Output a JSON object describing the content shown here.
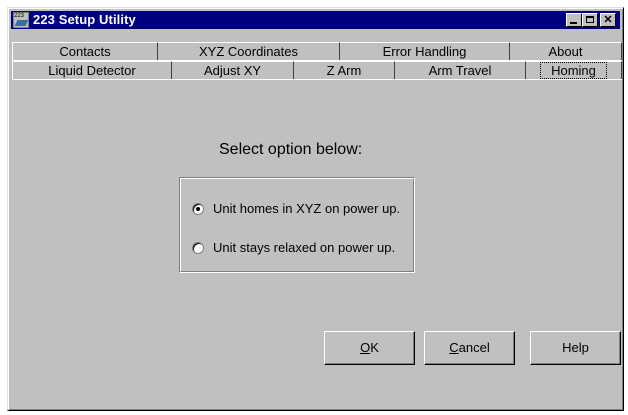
{
  "window": {
    "title": "223 Setup Utility",
    "icon_label": "223",
    "controls": [
      "minimize",
      "maximize",
      "close"
    ]
  },
  "tabs": {
    "row1": [
      "Contacts",
      "XYZ Coordinates",
      "Error Handling",
      "About"
    ],
    "row2": [
      "Liquid Detector",
      "Adjust XY",
      "Z Arm",
      "Arm Travel",
      "Homing"
    ],
    "active": "Homing"
  },
  "panel": {
    "prompt": "Select option below:",
    "options": [
      {
        "label": "Unit homes in XYZ on power up.",
        "selected": true
      },
      {
        "label": "Unit stays relaxed on power up.",
        "selected": false
      }
    ]
  },
  "buttons": {
    "ok": {
      "mnemonic": "O",
      "rest": "K"
    },
    "cancel": {
      "mnemonic": "C",
      "rest": "ancel"
    },
    "help": "Help"
  }
}
